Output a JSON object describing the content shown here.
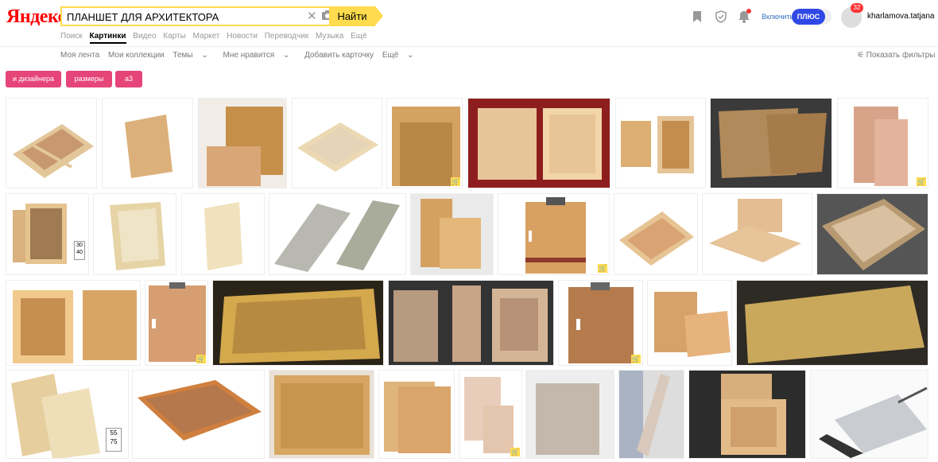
{
  "header": {
    "logo": "Яндекс",
    "search_value": "ПЛАНШЕТ ДЛЯ АРХИТЕКТОРА",
    "search_button": "Найти",
    "clear_icon": "close-icon",
    "camera_icon": "camera-icon"
  },
  "tabs": [
    "Поиск",
    "Картинки",
    "Видео",
    "Карты",
    "Маркет",
    "Новости",
    "Переводчик",
    "Музыка",
    "Ещё"
  ],
  "user": {
    "enable_label": "Включить",
    "plus_label": "ПЛЮС",
    "badge_count": "32",
    "name": "kharlamova.tatjana"
  },
  "subnav": [
    "Моя лента",
    "Мои коллекции",
    "Темы",
    "Мне нравится",
    "Добавить карточку",
    "Ещё"
  ],
  "filters_label": "Показать фильтры",
  "chips": [
    "и дизайнера",
    "размеры",
    "а3"
  ],
  "image_badges": {
    "size1": "30\n40",
    "size2": "55\n75"
  },
  "colors": {
    "accent_yellow": "#ffdb4d",
    "chip_pink": "#e6457a",
    "plus_blue": "#2f48e6"
  }
}
